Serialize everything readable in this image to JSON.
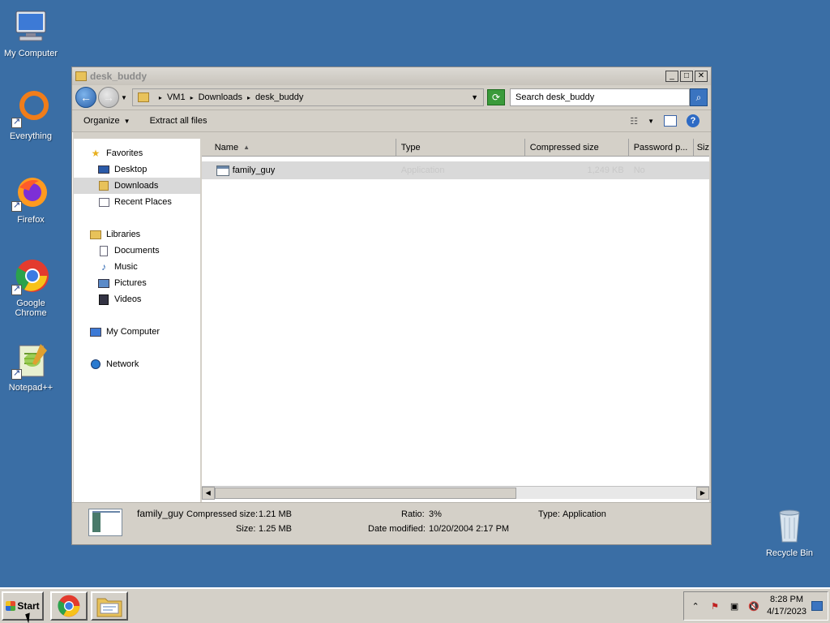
{
  "desktop": {
    "icons": [
      {
        "label": "My Computer"
      },
      {
        "label": "Everything"
      },
      {
        "label": "Firefox"
      },
      {
        "label": "Google Chrome"
      },
      {
        "label": "Notepad++"
      },
      {
        "label": "Recycle Bin"
      }
    ]
  },
  "window": {
    "title": "desk_buddy",
    "address": {
      "crumbs": [
        "VM1",
        "Downloads",
        "desk_buddy"
      ]
    },
    "search_placeholder": "Search desk_buddy",
    "commands": {
      "organize": "Organize",
      "extract": "Extract all files"
    },
    "nav": {
      "favorites": "Favorites",
      "desktop": "Desktop",
      "downloads": "Downloads",
      "recent": "Recent Places",
      "libraries": "Libraries",
      "documents": "Documents",
      "music": "Music",
      "pictures": "Pictures",
      "videos": "Videos",
      "my_computer": "My Computer",
      "network": "Network"
    },
    "columns": {
      "name": "Name",
      "type": "Type",
      "compressed": "Compressed size",
      "password": "Password p...",
      "size": "Siz"
    },
    "files": [
      {
        "name": "family_guy",
        "type": "Application",
        "compressed": "1,249 KB",
        "password": "No"
      }
    ],
    "details": {
      "name": "family_guy",
      "compressed_label": "Compressed size:",
      "compressed_value": "1.21 MB",
      "size_label": "Size:",
      "size_value": "1.25 MB",
      "ratio_label": "Ratio:",
      "ratio_value": "3%",
      "modified_label": "Date modified:",
      "modified_value": "10/20/2004 2:17 PM",
      "type_label": "Type:",
      "type_value": "Application"
    }
  },
  "taskbar": {
    "start": "Start",
    "time": "8:28 PM",
    "date": "4/17/2023"
  }
}
